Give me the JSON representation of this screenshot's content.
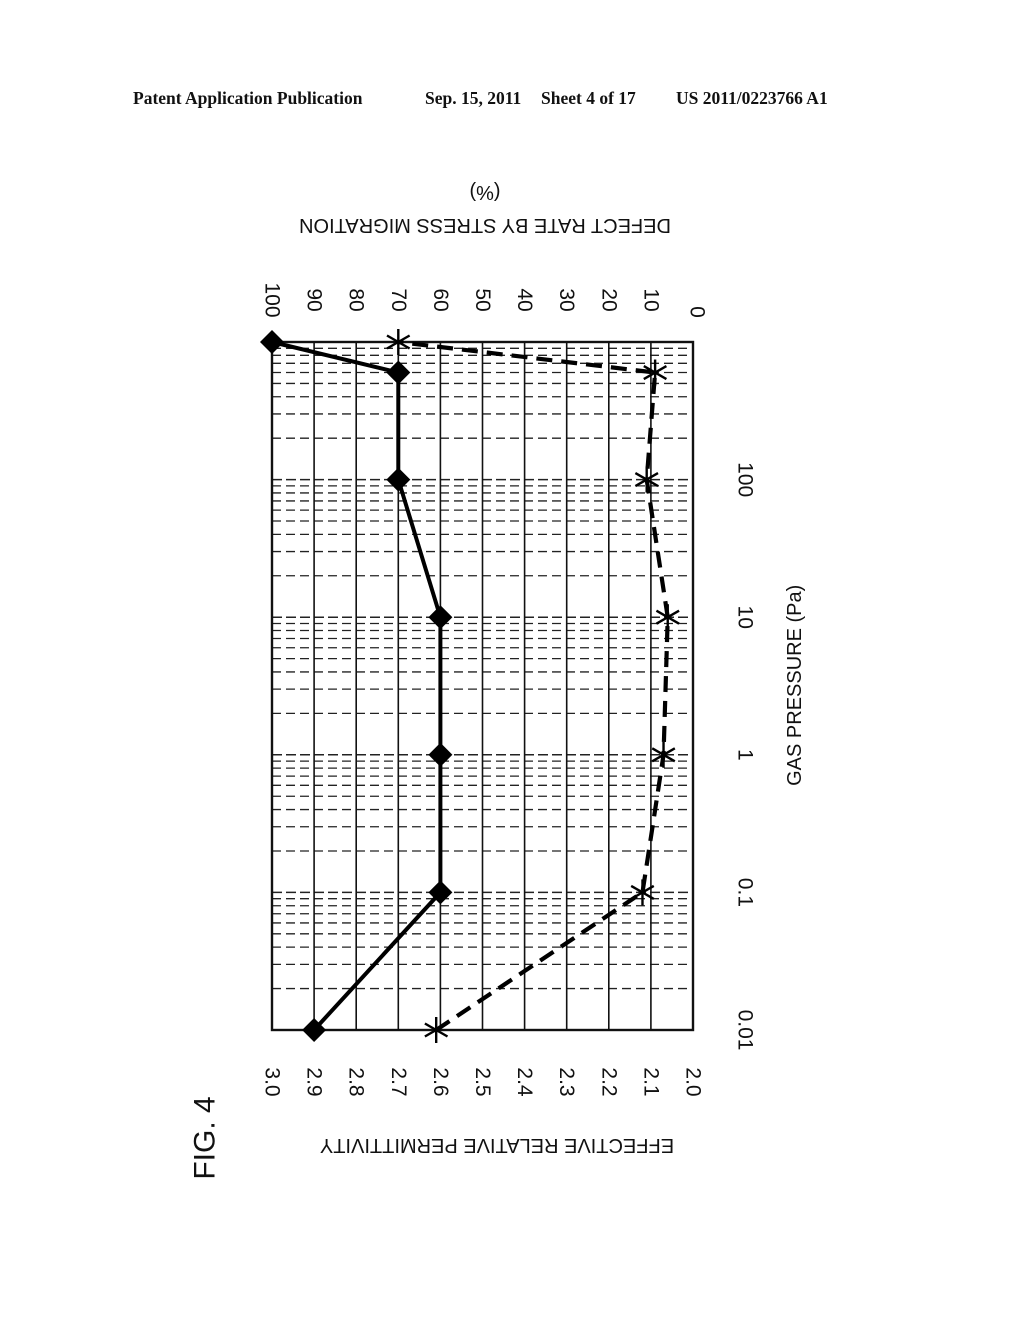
{
  "header": {
    "publication": "Patent Application Publication",
    "date": "Sep. 15, 2011",
    "sheet": "Sheet 4 of 17",
    "number": "US 2011/0223766 A1"
  },
  "figure_label": "FIG. 4",
  "chart_data": {
    "type": "line",
    "orientation": "rotated 90 degrees counter-clockwise on the page",
    "title": "",
    "xlabel": "GAS PRESSURE (Pa)",
    "x_scale": "log",
    "xlim": [
      0.01,
      1000
    ],
    "x_ticks": [
      "0.01",
      "0.1",
      "1",
      "10",
      "100"
    ],
    "ylabel_left": "EFFECTIVE RELATIVE PERMITTIVITY",
    "ylim_left": [
      2.0,
      3.0
    ],
    "y_ticks_left": [
      "3.0",
      "2.9",
      "2.8",
      "2.7",
      "2.6",
      "2.5",
      "2.4",
      "2.3",
      "2.2",
      "2.1",
      "2.0"
    ],
    "ylabel_right": "DEFECT RATE BY STRESS MIGRATION",
    "ylabel_right_unit": "(%)",
    "ylim_right": [
      0,
      100
    ],
    "y_ticks_right": [
      "100",
      "90",
      "80",
      "70",
      "60",
      "50",
      "40",
      "30",
      "20",
      "10",
      "0"
    ],
    "grid": true,
    "series": [
      {
        "name": "Effective relative permittivity",
        "axis": "left",
        "marker": "diamond",
        "line": "solid",
        "x": [
          0.01,
          0.1,
          1,
          10,
          100,
          600,
          1000
        ],
        "values": [
          2.9,
          2.6,
          2.6,
          2.6,
          2.7,
          2.7,
          3.0
        ]
      },
      {
        "name": "Defect rate by stress migration",
        "axis": "right",
        "marker": "asterisk",
        "line": "dashed",
        "x": [
          0.01,
          0.1,
          1,
          10,
          100,
          600,
          1000
        ],
        "values": [
          61,
          12,
          7,
          6,
          11,
          9,
          70
        ]
      }
    ]
  }
}
